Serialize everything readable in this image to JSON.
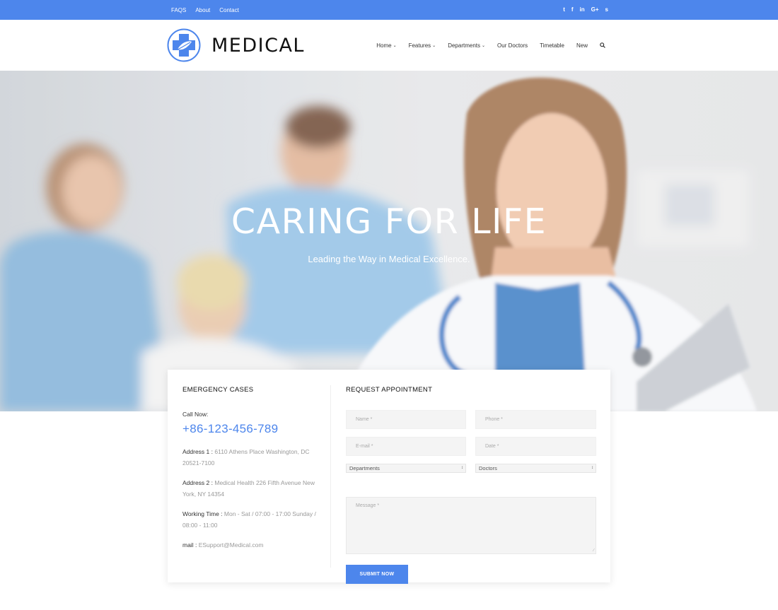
{
  "colors": {
    "accent": "#4d86ec",
    "topbar": "#4d86ec",
    "text": "#333333",
    "muted": "#999999"
  },
  "topbar": {
    "links": [
      "FAQS",
      "About",
      "Contact"
    ],
    "social_icons": [
      "twitter-icon",
      "facebook-icon",
      "linkedin-icon",
      "google-plus-icon",
      "skype-icon"
    ],
    "social_glyphs": [
      "t",
      "f",
      "in",
      "G+",
      "s"
    ]
  },
  "header": {
    "logo_text": "MEDICAL",
    "nav": [
      {
        "label": "Home",
        "dropdown": true
      },
      {
        "label": "Features",
        "dropdown": true
      },
      {
        "label": "Departments",
        "dropdown": true
      },
      {
        "label": "Our Doctors",
        "dropdown": false
      },
      {
        "label": "Timetable",
        "dropdown": false
      },
      {
        "label": "New",
        "dropdown": false
      }
    ]
  },
  "hero": {
    "title": "CARING FOR LIFE",
    "subtitle": "Leading the Way in Medical Excellence."
  },
  "emergency": {
    "heading": "EMERGENCY CASES",
    "call_label": "Call Now:",
    "phone": "+86-123-456-789",
    "address1_label": "Address 1 :",
    "address1_value": "6110 Athens Place Washington, DC 20521-7100",
    "address2_label": "Address 2 :",
    "address2_value": "Medical Health 226 Fifth Avenue New York, NY 14354",
    "hours_label": "Working Time :",
    "hours_value": "Mon - Sat / 07:00 - 17:00 Sunday / 08:00 - 11:00",
    "mail_label": "mail :",
    "mail_value": "ESupport@Medical.com"
  },
  "appointment": {
    "heading": "REQUEST APPOINTMENT",
    "name_placeholder": "Name *",
    "phone_placeholder": "Phone *",
    "email_placeholder": "E-mail *",
    "date_placeholder": "Date *",
    "departments_selected": "Departments",
    "doctors_selected": "Doctors",
    "message_placeholder": "Message *",
    "submit_label": "SUBMIT NOW"
  }
}
